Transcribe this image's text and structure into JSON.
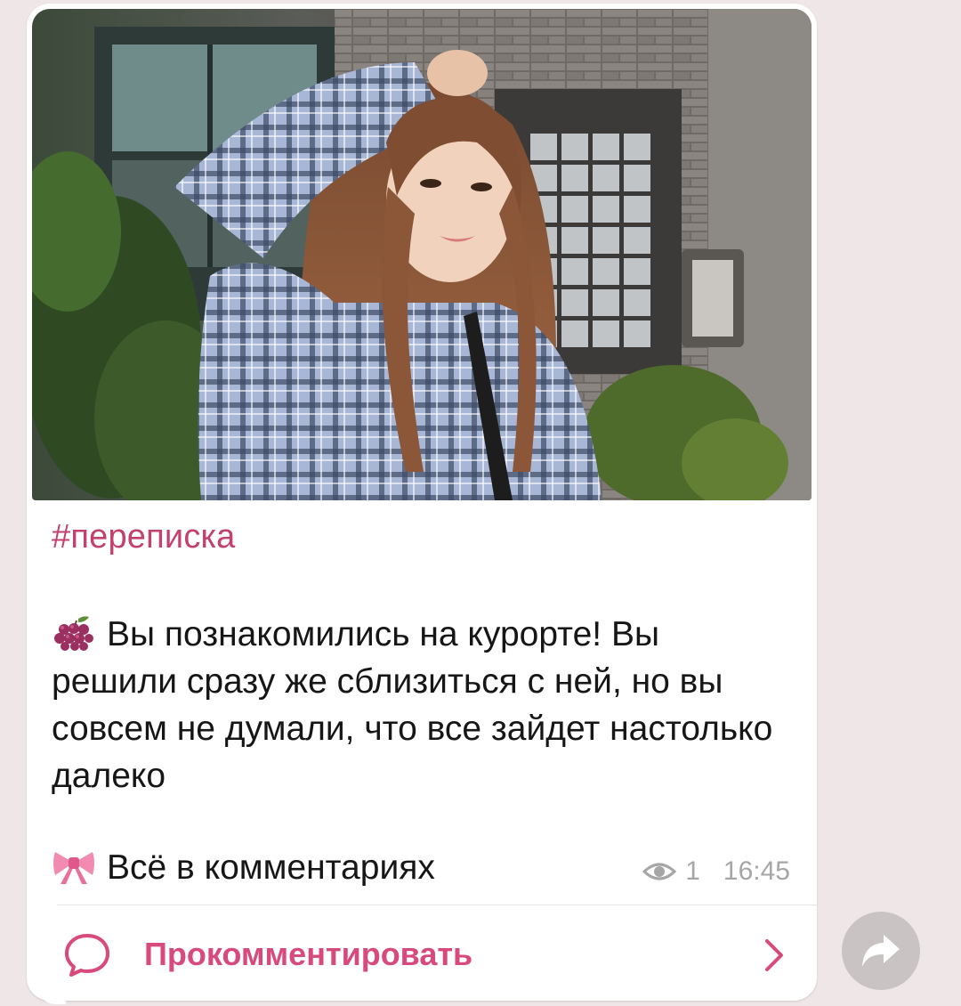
{
  "post": {
    "hashtag": "#переписка",
    "body_text": "Вы познакомились на курорте! Вы решили сразу же сблизиться с ней, но вы совсем не думали, что все зайдет настолько далеко",
    "body_emoji": "grapes-icon",
    "footer_text": "Всё в комментариях",
    "footer_emoji": "ribbon-icon",
    "views": "1",
    "time": "16:45"
  },
  "comments": {
    "label": "Прокомментировать"
  },
  "colors": {
    "accent": "#d8497d",
    "hashtag": "#c2416f",
    "meta": "#a6a6a6",
    "background": "#efe7e7"
  }
}
